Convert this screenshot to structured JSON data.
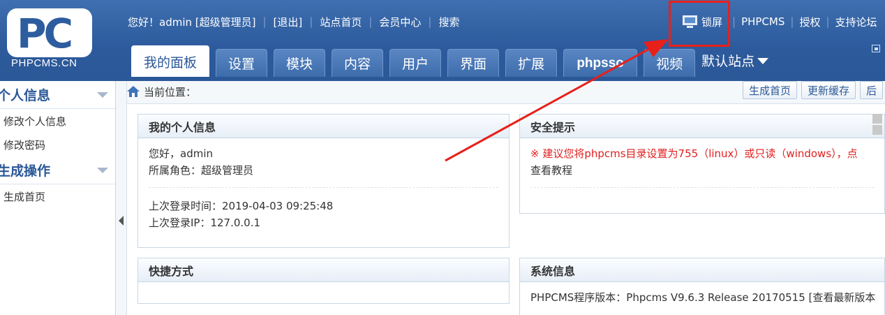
{
  "logo": {
    "letters": "PC",
    "text": "PHPCMS.CN"
  },
  "topbar": {
    "greeting": "您好！admin [超级管理员]",
    "logout": "[退出]",
    "links": [
      "站点首页",
      "会员中心",
      "搜索"
    ]
  },
  "toplinks": {
    "lock": "锁屏",
    "phpcms": "PHPCMS",
    "auth": "授权",
    "forum": "支持论坛"
  },
  "tabs": [
    {
      "label": "我的面板"
    },
    {
      "label": "设置"
    },
    {
      "label": "模块"
    },
    {
      "label": "内容"
    },
    {
      "label": "用户"
    },
    {
      "label": "界面"
    },
    {
      "label": "扩展"
    },
    {
      "label": "phpsso"
    },
    {
      "label": "视频"
    }
  ],
  "site_select": {
    "label": "默认站点"
  },
  "sidebar": {
    "groups": [
      {
        "title": "个人信息",
        "items": [
          "修改个人信息",
          "修改密码"
        ]
      },
      {
        "title": "生成操作",
        "items": [
          "生成首页"
        ]
      }
    ]
  },
  "crumb": {
    "label": "当前位置：",
    "buttons": [
      "生成首页",
      "更新缓存",
      "后"
    ]
  },
  "panels": {
    "profile": {
      "title": "我的个人信息",
      "hello": "您好，admin",
      "role": "所属角色：超级管理员",
      "last_time": "上次登录时间：2019-04-03 09:25:48",
      "last_ip": "上次登录IP：127.0.0.1"
    },
    "security": {
      "title": "安全提示",
      "warning": "※ 建议您将phpcms目录设置为755（linux）或只读（windows），点",
      "tutorial": "查看教程"
    },
    "shortcuts": {
      "title": "快捷方式"
    },
    "sysinfo": {
      "title": "系统信息",
      "version": "PHPCMS程序版本：Phpcms V9.6.3 Release 20170515 [查看最新版本"
    }
  },
  "colors": {
    "header_blue": "#2b5897",
    "annotation_red": "#e8201a",
    "warning_red": "#e02020"
  }
}
